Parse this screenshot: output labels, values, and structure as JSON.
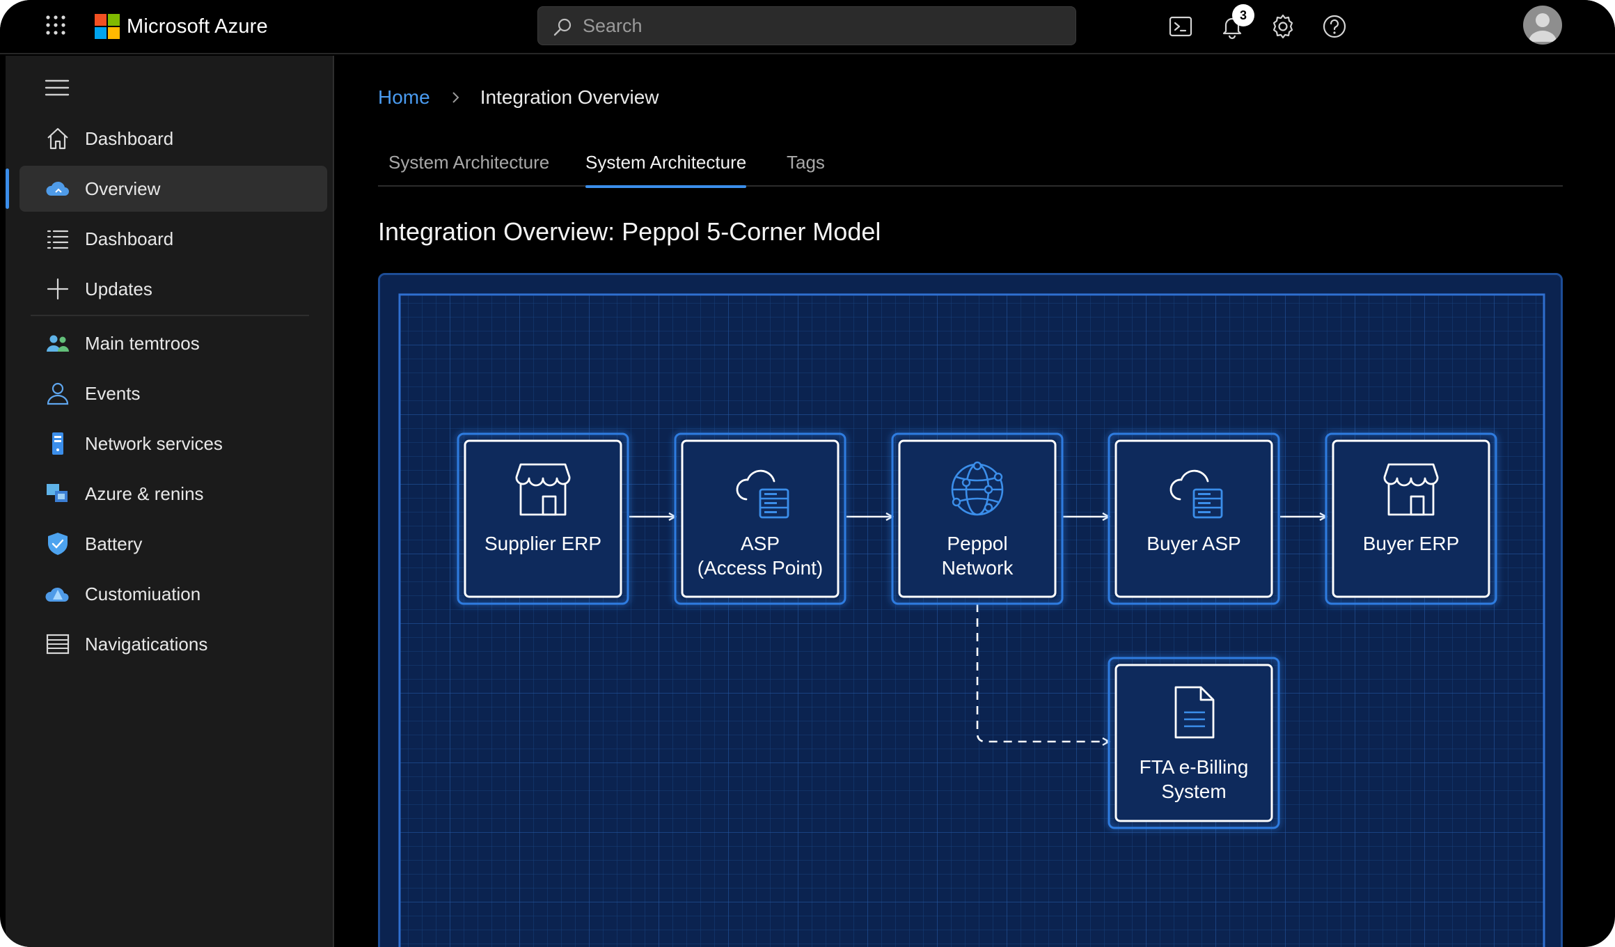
{
  "app": {
    "brand": "Microsoft Azure",
    "search_placeholder": "Search",
    "notifications_count": "3",
    "top_icons": [
      "cloud-shell-icon",
      "bell-icon",
      "gear-icon",
      "help-icon",
      "avatar"
    ]
  },
  "sidebar": {
    "items": [
      {
        "label": "Dashboard",
        "icon": "home-icon"
      },
      {
        "label": "Overview",
        "icon": "cloud-icon",
        "active": true
      },
      {
        "label": "Dashboard",
        "icon": "list-icon"
      },
      {
        "label": "Updates",
        "icon": "plus-icon"
      },
      {
        "label": "Main temtroos",
        "icon": "users-icon"
      },
      {
        "label": "Events",
        "icon": "person-icon"
      },
      {
        "label": "Network services",
        "icon": "server-icon"
      },
      {
        "label": "Azure & renins",
        "icon": "resources-icon"
      },
      {
        "label": "Battery",
        "icon": "shield-icon"
      },
      {
        "label": "Customiuation",
        "icon": "cloud-tree-icon"
      },
      {
        "label": "Navigatications",
        "icon": "table-icon"
      }
    ]
  },
  "breadcrumb": {
    "home": "Home",
    "current": "Integration Overview"
  },
  "tabs": [
    {
      "label": "System Architecture",
      "active": false
    },
    {
      "label": "System Architecture",
      "active": true
    },
    {
      "label": "Tags",
      "active": false
    }
  ],
  "page_title": "Integration Overview: Peppol 5-Corner Model",
  "diagram": {
    "nodes": [
      {
        "label_1": "Supplier ERP",
        "label_2": "",
        "icon": "store-icon"
      },
      {
        "label_1": "ASP",
        "label_2": "(Access Point)",
        "icon": "cloud-server-icon"
      },
      {
        "label_1": "Peppol",
        "label_2": "Network",
        "icon": "globe-network-icon"
      },
      {
        "label_1": "Buyer ASP",
        "label_2": "",
        "icon": "cloud-server-icon"
      },
      {
        "label_1": "Buyer ERP",
        "label_2": "",
        "icon": "store-icon"
      },
      {
        "label_1": "FTA e-Billing",
        "label_2": "System",
        "icon": "document-icon"
      }
    ],
    "colors": {
      "panel_bg": "#0b2350",
      "grid": "#1e4a8a",
      "node_glow": "#2f7be0",
      "accent": "#3b8eea"
    }
  }
}
